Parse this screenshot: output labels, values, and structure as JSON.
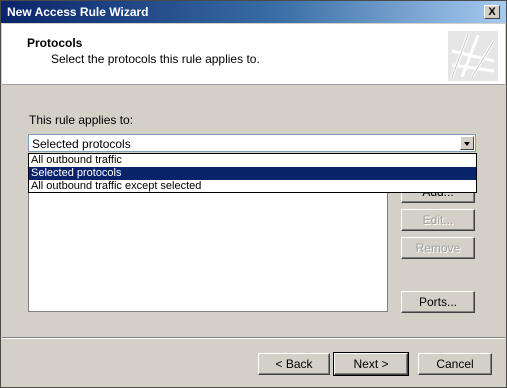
{
  "window": {
    "title": "New Access Rule Wizard",
    "close_label": "X"
  },
  "header": {
    "title": "Protocols",
    "subtitle": "Select the protocols this rule applies to."
  },
  "rule": {
    "label": "This rule applies to:",
    "selected": "Selected protocols",
    "options": [
      "All outbound traffic",
      "Selected protocols",
      "All outbound traffic except selected"
    ]
  },
  "side_buttons": {
    "add": "Add...",
    "edit": "Edit...",
    "remove": "Remove",
    "ports": "Ports..."
  },
  "nav": {
    "back": "< Back",
    "next": "Next >",
    "cancel": "Cancel"
  },
  "colors": {
    "titlebar": "#0a246a",
    "selection": "#0a246a",
    "face": "#d4d0c8"
  }
}
